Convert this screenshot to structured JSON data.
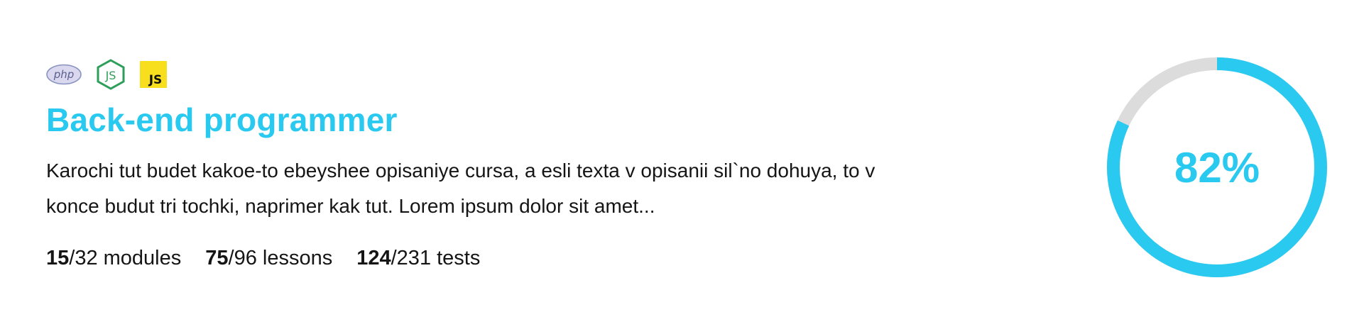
{
  "course": {
    "tech_icons": [
      {
        "name": "php-icon",
        "label": "php"
      },
      {
        "name": "nodejs-icon",
        "label": "JS"
      },
      {
        "name": "javascript-icon",
        "label": "JS"
      }
    ],
    "title": "Back-end programmer",
    "description": "Karochi tut budet kakoe-to ebeyshee opisaniye cursa, a esli texta v opisanii sil`no dohuya, to v konce budut tri tochki, naprimer kak tut. Lorem ipsum dolor sit amet...",
    "stats": {
      "modules_done": "15",
      "modules_total": "/32 modules",
      "lessons_done": "75",
      "lessons_total": "/96 lessons",
      "tests_done": "124",
      "tests_total": "/231 tests"
    },
    "progress": {
      "value": 0.82,
      "label": "82%"
    }
  },
  "colors": {
    "accent": "#29c9f0",
    "track": "#dcdcdc",
    "php": "#8892bf",
    "node": "#2f9e5a",
    "js_bg": "#f7df1e"
  }
}
